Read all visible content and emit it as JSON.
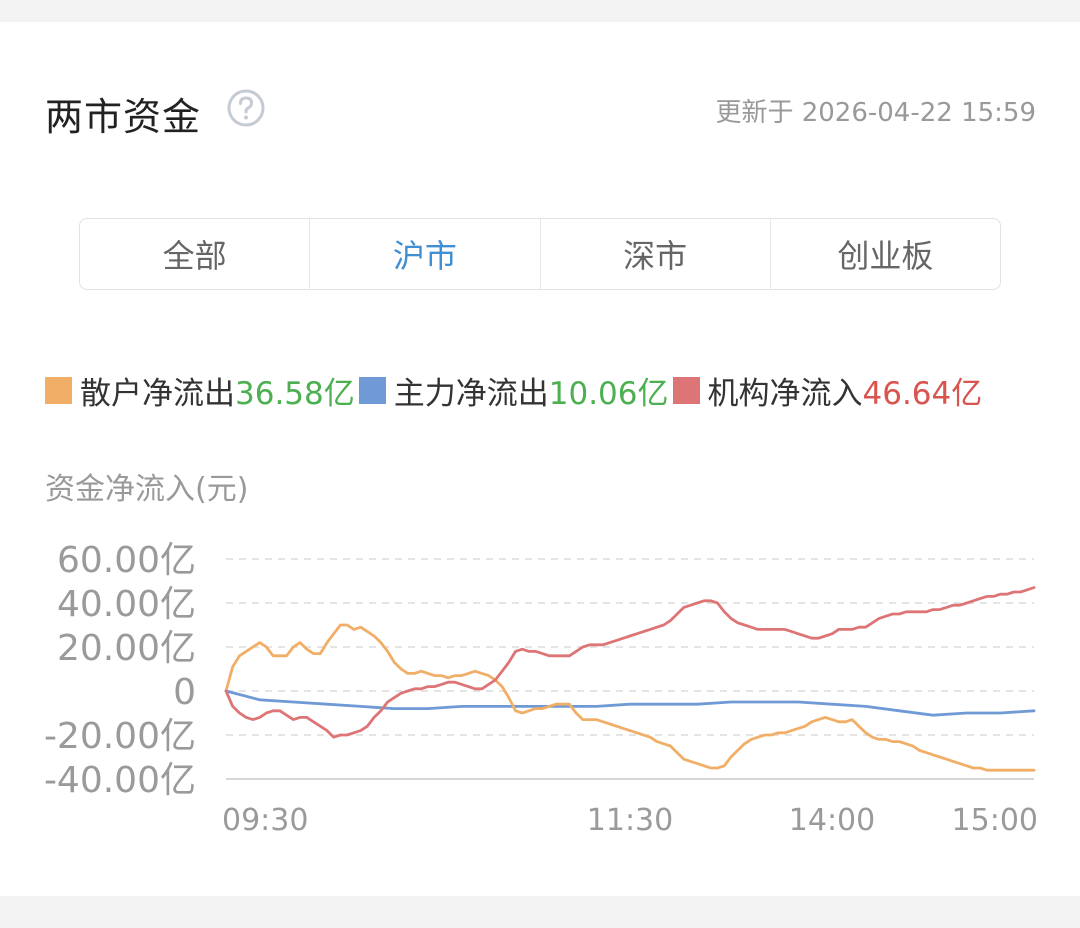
{
  "header": {
    "title": "两市资金",
    "update_text": "更新于 2026-04-22 15:59"
  },
  "tabs": [
    {
      "label": "全部"
    },
    {
      "label": "沪市",
      "active": true
    },
    {
      "label": "深市"
    },
    {
      "label": "创业板"
    }
  ],
  "legend": {
    "items": [
      {
        "label": "散户净流出",
        "value": "36.58亿",
        "swatch": "#f0ae66",
        "value_color": "#4caf50"
      },
      {
        "label": "主力净流出",
        "value": "10.06亿",
        "swatch": "#6f9ad6",
        "value_color": "#4caf50"
      },
      {
        "label": "机构净流入",
        "value": "46.64亿",
        "swatch": "#dd7475",
        "value_color": "#d9534f"
      }
    ]
  },
  "colors": {
    "retail": "#f0ae66",
    "main": "#6f9ad6",
    "institution": "#dd7475",
    "outflow": "#4caf50",
    "inflow": "#d9534f",
    "tab_active": "#3f8fd2"
  },
  "chart_data": {
    "type": "line",
    "ylabel": "资金净流入(元)",
    "ylim": [
      -40,
      60
    ],
    "y_ticks": [
      60,
      40,
      20,
      0,
      -20,
      -40
    ],
    "y_tick_labels": [
      "60.00亿",
      "40.00亿",
      "20.00亿",
      "0",
      "-20.00亿",
      "-40.00亿"
    ],
    "x_range": [
      0,
      240
    ],
    "x_ticks": [
      0,
      120,
      180,
      240
    ],
    "x_tick_labels": [
      "09:30",
      "11:30",
      "14:00",
      "15:00"
    ],
    "grid": true,
    "series": [
      {
        "name": "散户净流出",
        "color": "#f0ae66",
        "x": [
          0,
          2,
          4,
          6,
          8,
          10,
          12,
          14,
          16,
          18,
          20,
          22,
          24,
          26,
          28,
          30,
          32,
          34,
          36,
          38,
          40,
          42,
          44,
          46,
          48,
          50,
          52,
          54,
          56,
          58,
          60,
          62,
          64,
          66,
          68,
          70,
          72,
          74,
          76,
          78,
          80,
          82,
          84,
          86,
          88,
          90,
          92,
          94,
          96,
          98,
          100,
          102,
          104,
          106,
          108,
          110,
          112,
          114,
          116,
          118,
          120,
          122,
          124,
          126,
          128,
          130,
          132,
          134,
          136,
          138,
          140,
          142,
          144,
          146,
          148,
          150,
          152,
          154,
          156,
          158,
          160,
          162,
          164,
          166,
          168,
          170,
          172,
          174,
          176,
          178,
          180,
          182,
          184,
          186,
          188,
          190,
          192,
          194,
          196,
          198,
          200,
          202,
          204,
          206,
          208,
          210,
          212,
          214,
          216,
          218,
          220,
          222,
          224,
          226,
          228,
          230,
          232,
          234,
          236,
          238,
          240
        ],
        "values": [
          0,
          11,
          16,
          18,
          20,
          22,
          20,
          16,
          16,
          16,
          20,
          22,
          19,
          17,
          17,
          22,
          26,
          30,
          30,
          28,
          29,
          27,
          25,
          22,
          18,
          13,
          10,
          8,
          8,
          9,
          8,
          7,
          7,
          6,
          7,
          7,
          8,
          9,
          8,
          7,
          5,
          2,
          -3,
          -9,
          -10,
          -9,
          -8,
          -8,
          -7,
          -6,
          -6,
          -6,
          -10,
          -13,
          -13,
          -13,
          -14,
          -15,
          -16,
          -17,
          -18,
          -19,
          -20,
          -21,
          -23,
          -24,
          -25,
          -28,
          -31,
          -32,
          -33,
          -34,
          -35,
          -35,
          -34,
          -30,
          -27,
          -24,
          -22,
          -21,
          -20,
          -20,
          -19,
          -19,
          -18,
          -17,
          -16,
          -14,
          -13,
          -12,
          -13,
          -14,
          -14,
          -13,
          -16,
          -19,
          -21,
          -22,
          -22,
          -23,
          -23,
          -24,
          -25,
          -27,
          -28,
          -29,
          -30,
          -31,
          -32,
          -33,
          -34,
          -35,
          -35,
          -36,
          -36,
          -36,
          -36,
          -36,
          -36,
          -36,
          -36
        ]
      },
      {
        "name": "主力净流出",
        "color": "#6f9ad6",
        "x": [
          0,
          10,
          20,
          30,
          40,
          50,
          60,
          70,
          80,
          90,
          100,
          110,
          120,
          130,
          140,
          150,
          160,
          170,
          180,
          190,
          200,
          210,
          220,
          230,
          240
        ],
        "values": [
          0,
          -4,
          -5,
          -6,
          -7,
          -8,
          -8,
          -7,
          -7,
          -7,
          -7,
          -7,
          -6,
          -6,
          -6,
          -5,
          -5,
          -5,
          -6,
          -7,
          -9,
          -11,
          -10,
          -10,
          -9
        ]
      },
      {
        "name": "机构净流入",
        "color": "#dd7475",
        "x": [
          0,
          2,
          4,
          6,
          8,
          10,
          12,
          14,
          16,
          18,
          20,
          22,
          24,
          26,
          28,
          30,
          32,
          34,
          36,
          38,
          40,
          42,
          44,
          46,
          48,
          50,
          52,
          54,
          56,
          58,
          60,
          62,
          64,
          66,
          68,
          70,
          72,
          74,
          76,
          78,
          80,
          82,
          84,
          86,
          88,
          90,
          92,
          94,
          96,
          98,
          100,
          102,
          104,
          106,
          108,
          110,
          112,
          114,
          116,
          118,
          120,
          122,
          124,
          126,
          128,
          130,
          132,
          134,
          136,
          138,
          140,
          142,
          144,
          146,
          148,
          150,
          152,
          154,
          156,
          158,
          160,
          162,
          164,
          166,
          168,
          170,
          172,
          174,
          176,
          178,
          180,
          182,
          184,
          186,
          188,
          190,
          192,
          194,
          196,
          198,
          200,
          202,
          204,
          206,
          208,
          210,
          212,
          214,
          216,
          218,
          220,
          222,
          224,
          226,
          228,
          230,
          232,
          234,
          236,
          238,
          240
        ],
        "values": [
          0,
          -7,
          -10,
          -12,
          -13,
          -12,
          -10,
          -9,
          -9,
          -11,
          -13,
          -12,
          -12,
          -14,
          -16,
          -18,
          -21,
          -20,
          -20,
          -19,
          -18,
          -16,
          -12,
          -9,
          -5,
          -3,
          -1,
          0,
          1,
          1,
          2,
          2,
          3,
          4,
          4,
          3,
          2,
          1,
          1,
          3,
          5,
          9,
          13,
          18,
          19,
          18,
          18,
          17,
          16,
          16,
          16,
          16,
          18,
          20,
          21,
          21,
          21,
          22,
          23,
          24,
          25,
          26,
          27,
          28,
          29,
          30,
          32,
          35,
          38,
          39,
          40,
          41,
          41,
          40,
          36,
          33,
          31,
          30,
          29,
          28,
          28,
          28,
          28,
          28,
          27,
          26,
          25,
          24,
          24,
          25,
          26,
          28,
          28,
          28,
          29,
          29,
          31,
          33,
          34,
          35,
          35,
          36,
          36,
          36,
          36,
          37,
          37,
          38,
          39,
          39,
          40,
          41,
          42,
          43,
          43,
          44,
          44,
          45,
          45,
          46,
          47
        ]
      }
    ]
  }
}
